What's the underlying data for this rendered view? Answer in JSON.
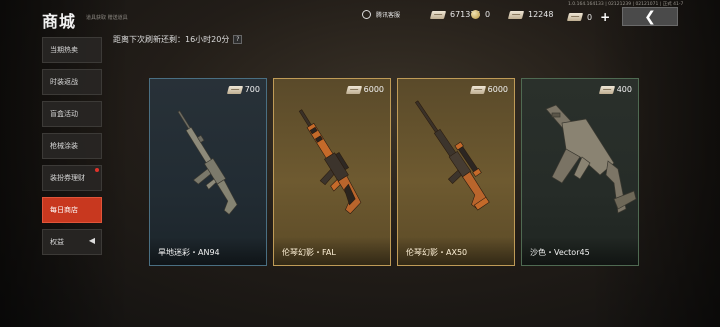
{
  "header": {
    "title": "商城",
    "subtitle": "道具获取 赠送道具",
    "version": "1.0.164.164133 | 02121239 | 02121071 | 正式 41-7"
  },
  "currency": {
    "service_label": "腾讯客服",
    "coupon_a": "671375",
    "coins": "0",
    "coupon_b": "12248",
    "coupon_c": "0",
    "add_symbol": "+"
  },
  "back_button": {
    "symbol": "❮"
  },
  "sidebar": {
    "items": [
      {
        "label": "当期热卖"
      },
      {
        "label": "时装返战"
      },
      {
        "label": "盲盒活动"
      },
      {
        "label": "枪械涂装"
      },
      {
        "label": "装扮券理财"
      },
      {
        "label": "每日商店"
      },
      {
        "label": "权益"
      }
    ],
    "active_index": 5,
    "arrow_symbol": "◀"
  },
  "refresh": {
    "text": "距离下次刷新还剩：16小时20分",
    "help": "?"
  },
  "cards": [
    {
      "price": "700",
      "name": "旱地迷彩・AN94",
      "rarity_color": "#4a6f82",
      "icon": "assault-rifle-icon"
    },
    {
      "price": "6000",
      "name": "伦琴幻影・FAL",
      "rarity_color": "#bf9b57",
      "icon": "battle-rifle-icon"
    },
    {
      "price": "6000",
      "name": "伦琴幻影・AX50",
      "rarity_color": "#bf9b57",
      "icon": "sniper-rifle-icon"
    },
    {
      "price": "400",
      "name": "沙色・Vector45",
      "rarity_color": "#4f6a52",
      "icon": "smg-icon"
    }
  ],
  "colors": {
    "active_tab": "#c8381f",
    "gold_frame": "#bf9b57"
  }
}
